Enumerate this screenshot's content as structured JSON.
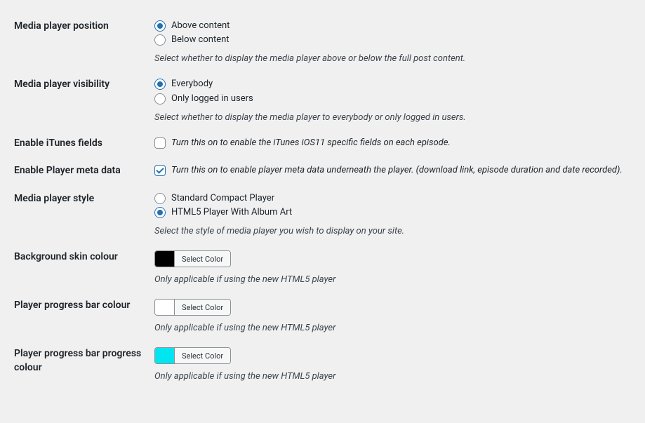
{
  "fields": {
    "mediaPlayerPosition": {
      "label": "Media player position",
      "options": {
        "above": "Above content",
        "below": "Below content"
      },
      "description": "Select whether to display the media player above or below the full post content."
    },
    "mediaPlayerVisibility": {
      "label": "Media player visibility",
      "options": {
        "everybody": "Everybody",
        "loggedIn": "Only logged in users"
      },
      "description": "Select whether to display the media player to everybody or only logged in users."
    },
    "enableItunes": {
      "label": "Enable iTunes fields",
      "checkboxLabel": "Turn this on to enable the iTunes iOS11 specific fields on each episode."
    },
    "enablePlayerMeta": {
      "label": "Enable Player meta data",
      "checkboxLabel": "Turn this on to enable player meta data underneath the player. (download link, episode duration and date recorded)."
    },
    "mediaPlayerStyle": {
      "label": "Media player style",
      "options": {
        "standard": "Standard Compact Player",
        "html5": "HTML5 Player With Album Art"
      },
      "description": "Select the style of media player you wish to display on your site."
    },
    "backgroundSkinColour": {
      "label": "Background skin colour",
      "selectColorLabel": "Select Color",
      "swatchColor": "#000000",
      "help": "Only applicable if using the new HTML5 player"
    },
    "playerProgressBarColour": {
      "label": "Player progress bar colour",
      "selectColorLabel": "Select Color",
      "swatchColor": "#ffffff",
      "help": "Only applicable if using the new HTML5 player"
    },
    "playerProgressBarProgressColour": {
      "label": "Player progress bar progress colour",
      "selectColorLabel": "Select Color",
      "swatchColor": "#00e5f0",
      "help": "Only applicable if using the new HTML5 player"
    }
  }
}
